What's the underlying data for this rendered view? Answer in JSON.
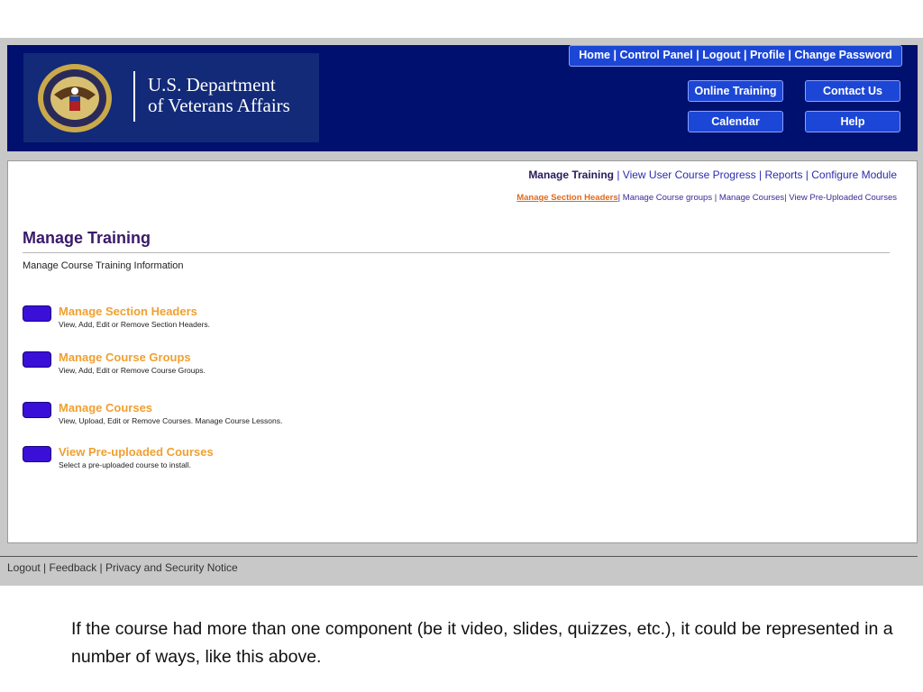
{
  "header": {
    "logo": {
      "line1": "U.S. Department",
      "line2": "of Veterans Affairs",
      "seal_icon": "va-seal-icon"
    },
    "top_links": [
      "Home",
      "Control Panel",
      "Logout",
      "Profile",
      "Change Password"
    ],
    "buttons": {
      "online_training": "Online Training",
      "contact_us": "Contact Us",
      "calendar": "Calendar",
      "help": "Help"
    }
  },
  "subnav": {
    "primary": [
      "Manage Training",
      "View User Course Progress",
      "Reports",
      "Configure Module"
    ],
    "secondary": [
      "Manage Section Headers",
      "Manage Course groups",
      "Manage Courses",
      "View Pre-Uploaded Courses"
    ]
  },
  "page": {
    "title": "Manage Training",
    "subtitle": "Manage Course Training Information",
    "items": [
      {
        "title": "Manage Section Headers",
        "desc": "View, Add, Edit or Remove Section Headers."
      },
      {
        "title": "Manage Course Groups",
        "desc": "View, Add, Edit or Remove Course Groups."
      },
      {
        "title": "Manage Courses",
        "desc": "View, Upload, Edit or Remove Courses. Manage Course Lessons."
      },
      {
        "title": "View Pre-uploaded Courses",
        "desc": "Select a pre-uploaded course to install."
      }
    ]
  },
  "footer": [
    "Logout",
    "Feedback",
    "Privacy and Security Notice"
  ],
  "caption": "If the course had more than one component (be it video, slides, quizzes, etc.), it could be represented in a number of ways, like this above.",
  "colors": {
    "header_bg": "#00106e",
    "button_bg": "#1c47d6",
    "title": "#3a1a6a",
    "item_title": "#f0a030",
    "item_button": "#3a0fd8",
    "active_secondary": "#e06a1a"
  }
}
